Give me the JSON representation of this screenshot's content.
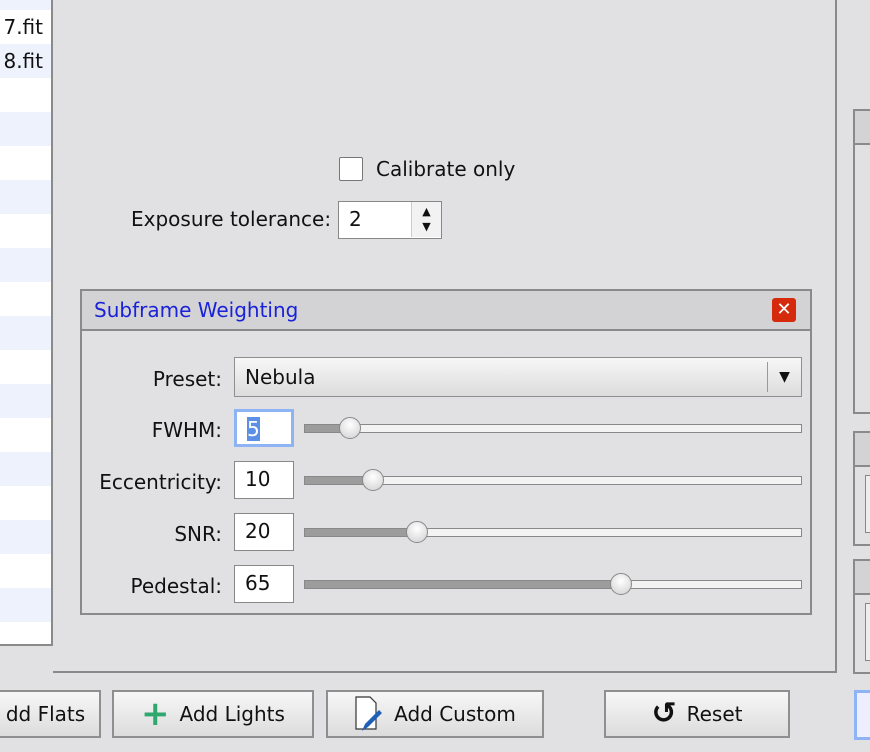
{
  "file_list": {
    "rows": [
      "",
      "7.fit",
      "8.fit",
      "",
      "",
      "",
      "",
      "",
      "",
      "",
      "",
      "",
      "",
      "",
      "",
      "",
      "",
      "",
      "",
      ""
    ]
  },
  "options": {
    "calibrate_only_label": "Calibrate only",
    "calibrate_only_checked": false,
    "exposure_tolerance_label": "Exposure tolerance:",
    "exposure_tolerance_value": "2"
  },
  "subframe_weighting": {
    "title": "Subframe Weighting",
    "preset_label": "Preset:",
    "preset_value": "Nebula",
    "params": [
      {
        "label": "FWHM:",
        "value": "5",
        "slider_fraction": 0.09
      },
      {
        "label": "Eccentricity:",
        "value": "10",
        "slider_fraction": 0.137
      },
      {
        "label": "SNR:",
        "value": "20",
        "slider_fraction": 0.226
      },
      {
        "label": "Pedestal:",
        "value": "65",
        "slider_fraction": 0.637
      }
    ],
    "close_color": "#d52a0c",
    "title_color": "#1a22d8"
  },
  "buttons": {
    "add_flats": "dd Flats",
    "add_lights": "Add Lights",
    "add_custom": "Add Custom",
    "reset": "Reset"
  }
}
